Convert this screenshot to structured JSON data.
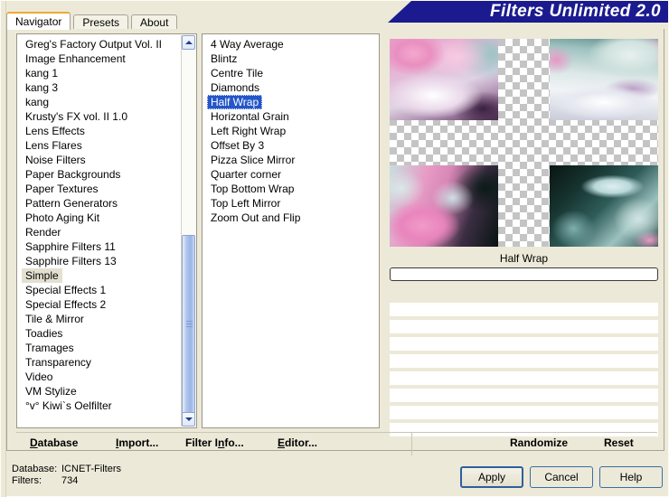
{
  "window": {
    "title": "Filters Unlimited 2.0",
    "accent_blue": "#1b1b8f",
    "background": "#ece9d8"
  },
  "tabs": [
    {
      "label": "Navigator",
      "active": true
    },
    {
      "label": "Presets",
      "active": false
    },
    {
      "label": "About",
      "active": false
    }
  ],
  "categories": {
    "selected": "Simple",
    "items": [
      "Greg's Factory Output Vol. II",
      "Image Enhancement",
      "kang 1",
      "kang 3",
      "kang",
      "Krusty's FX vol. II 1.0",
      "Lens Effects",
      "Lens Flares",
      "Noise Filters",
      "Paper Backgrounds",
      "Paper Textures",
      "Pattern Generators",
      "Photo Aging Kit",
      "Render",
      "Sapphire Filters 11",
      "Sapphire Filters 13",
      "Simple",
      "Special Effects 1",
      "Special Effects 2",
      "Tile & Mirror",
      "Toadies",
      "Tramages",
      "Transparency",
      "Video",
      "VM Stylize",
      "°v° Kiwi`s Oelfilter"
    ]
  },
  "filters": {
    "selected": "Half Wrap",
    "items": [
      "4 Way Average",
      "Blintz",
      "Centre Tile",
      "Diamonds",
      "Half Wrap",
      "Horizontal Grain",
      "Left Right Wrap",
      "Offset By 3",
      "Pizza Slice Mirror",
      "Quarter corner",
      "Top Bottom Wrap",
      "Top Left Mirror",
      "Zoom Out and Flip"
    ]
  },
  "preview": {
    "caption": "Half Wrap",
    "slider_value": ""
  },
  "actions": {
    "database": {
      "pre": "D",
      "accel": "",
      "post": "atabase",
      "accel_char": "D"
    },
    "items": [
      {
        "label": "Database",
        "accel_index": 0
      },
      {
        "label": "Import...",
        "accel_index": 0
      },
      {
        "label": "Filter Info...",
        "accel_index": 7
      },
      {
        "label": "Editor...",
        "accel_index": 0
      },
      {
        "label": "Randomize",
        "accel_index": -1
      },
      {
        "label": "Reset",
        "accel_index": -1
      }
    ]
  },
  "status": {
    "database_label": "Database:",
    "database_value": "ICNET-Filters",
    "filters_label": "Filters:",
    "filters_value": "734"
  },
  "buttons": {
    "apply": "Apply",
    "cancel": "Cancel",
    "help": "Help"
  }
}
